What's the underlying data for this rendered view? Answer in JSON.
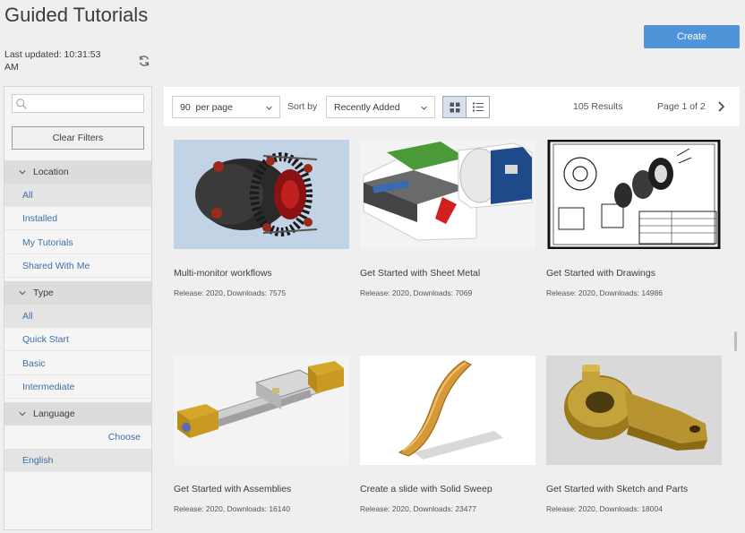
{
  "header": {
    "title": "Guided Tutorials",
    "create_label": "Create",
    "last_updated": "Last updated: 10:31:53 AM"
  },
  "sidebar": {
    "search_placeholder": "",
    "clear_filters_label": "Clear Filters",
    "groups": [
      {
        "label": "Location",
        "items": [
          "All",
          "Installed",
          "My Tutorials",
          "Shared With Me"
        ],
        "selected": "All"
      },
      {
        "label": "Type",
        "items": [
          "All",
          "Quick Start",
          "Basic",
          "Intermediate"
        ],
        "selected": "All"
      },
      {
        "label": "Language",
        "choose_label": "Choose",
        "items": [
          "English"
        ],
        "selected": "English"
      }
    ]
  },
  "toolbar": {
    "per_page": "90  per page",
    "sort_label": "Sort by",
    "sort_value": "Recently Added",
    "results": "105 Results",
    "page": "Page 1 of 2"
  },
  "cards": [
    {
      "title": "Multi-monitor workflows",
      "meta": "Release: 2020, Downloads: 7575",
      "thumb": "engine-icon"
    },
    {
      "title": "Get Started with Sheet Metal",
      "meta": "Release: 2020, Downloads: 7069",
      "thumb": "sheet-metal-icon"
    },
    {
      "title": "Get Started with Drawings",
      "meta": "Release: 2020, Downloads: 14986",
      "thumb": "drawing-icon"
    },
    {
      "title": "Get Started with Assemblies",
      "meta": "Release: 2020, Downloads: 16140",
      "thumb": "assembly-icon"
    },
    {
      "title": "Create a slide with Solid Sweep",
      "meta": "Release: 2020, Downloads: 23477",
      "thumb": "slide-icon"
    },
    {
      "title": "Get Started with Sketch and Parts",
      "meta": "Release: 2020, Downloads: 18004",
      "thumb": "part-icon"
    }
  ],
  "colors": {
    "accent": "#4f93d8",
    "link": "#3e6fa8",
    "background": "#efefef"
  }
}
